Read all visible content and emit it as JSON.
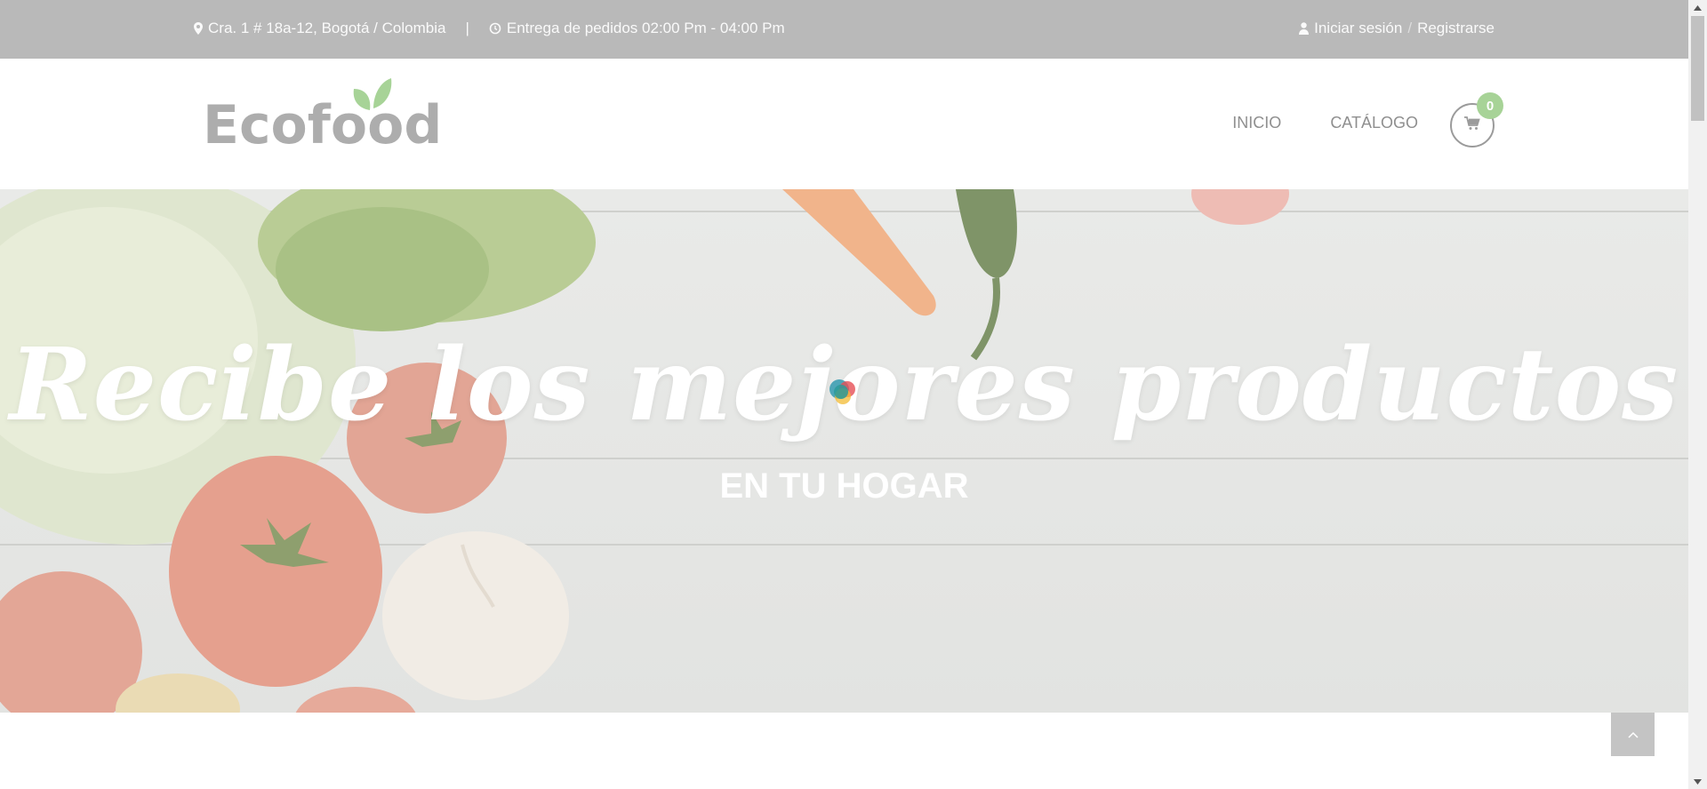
{
  "topbar": {
    "address": "Cra. 1 # 18a-12, Bogotá / Colombia",
    "separator": "|",
    "delivery": "Entrega de pedidos 02:00 Pm - 04:00 Pm",
    "login": "Iniciar sesión",
    "slash": "/",
    "register": "Registrarse",
    "icons": {
      "address": "map-marker-icon",
      "delivery": "clock-icon",
      "login": "user-icon"
    }
  },
  "header": {
    "logo_text": "Ecofood",
    "nav": {
      "home": "INICIO",
      "catalog": "CATÁLOGO"
    },
    "cart": {
      "icon": "shopping-cart-icon",
      "count": "0"
    }
  },
  "hero": {
    "title": "Recibe los mejores productos",
    "subtitle": "EN TU HOGAR"
  },
  "colors": {
    "topbar_bg": "#b9b9b9",
    "logo_gray": "#adadad",
    "leaf_green": "#a7d397",
    "nav_text": "#8f8f8f"
  }
}
